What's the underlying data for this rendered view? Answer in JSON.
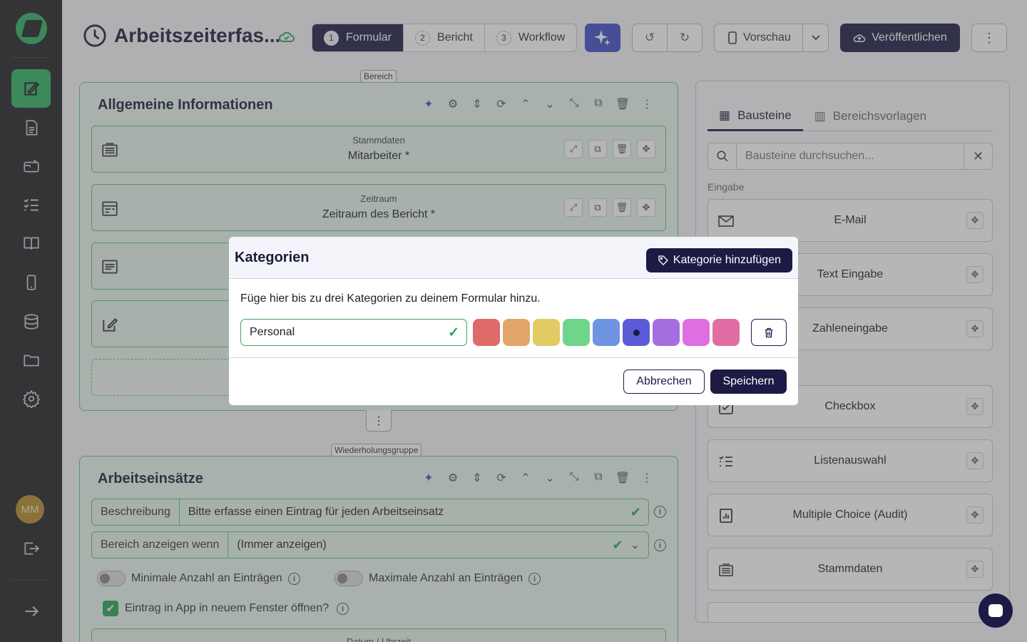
{
  "header": {
    "title": "Arbeitszeiterfas...",
    "steps": [
      {
        "num": "1",
        "label": "Formular"
      },
      {
        "num": "2",
        "label": "Bericht"
      },
      {
        "num": "3",
        "label": "Workflow"
      }
    ],
    "preview_label": "Vorschau",
    "publish_label": "Veröffentlichen"
  },
  "sidebar": {
    "avatar_initials": "MM",
    "items": [
      "form-editor-icon",
      "report-icon",
      "wallet-icon",
      "checklist-icon",
      "book-icon",
      "phone-icon",
      "database-icon",
      "folder-icon",
      "settings-icon"
    ]
  },
  "section1": {
    "tag": "Bereich",
    "title": "Allgemeine Informationen",
    "fields": [
      {
        "small": "Stammdaten",
        "main": "Mitarbeiter *"
      },
      {
        "small": "Zeitraum",
        "main": "Zeitraum des Bericht *"
      }
    ]
  },
  "section2": {
    "tag": "Wiederholungsgruppe",
    "title": "Arbeitseinsätze",
    "rows": [
      {
        "label": "Beschreibung",
        "value": "Bitte erfasse einen Eintrag für jeden Arbeitseinsatz"
      },
      {
        "label": "Bereich anzeigen wenn",
        "value": "(Immer anzeigen)"
      }
    ],
    "min_label": "Minimale Anzahl an Einträgen",
    "max_label": "Maximale Anzahl an Einträgen",
    "checkbox_label": "Eintrag in App in neuem Fenster öffnen?",
    "cut_label": "Datum / Uhrzeit"
  },
  "right_panel": {
    "tab_blocks": "Bausteine",
    "tab_templates": "Bereichsvorlagen",
    "search_placeholder": "Bausteine durchsuchen...",
    "group_input": "Eingabe",
    "blocks": [
      "E-Mail",
      "Text Eingabe",
      "Zahleneingabe",
      "Checkbox",
      "Listenauswahl",
      "Multiple Choice (Audit)",
      "Stammdaten"
    ]
  },
  "modal": {
    "title": "Kategorien",
    "add_label": "Kategorie hinzufügen",
    "description": "Füge hier bis zu drei Kategorien zu deinem Formular hinzu.",
    "category_value": "Personal",
    "colors": [
      "#e06a6a",
      "#e2a56a",
      "#e2cb63",
      "#6fd58b",
      "#6f94e2",
      "#5c5bd6",
      "#a46ee0",
      "#e06ee0",
      "#e06ea4"
    ],
    "selected_color_index": 5,
    "cancel_label": "Abbrechen",
    "save_label": "Speichern"
  }
}
